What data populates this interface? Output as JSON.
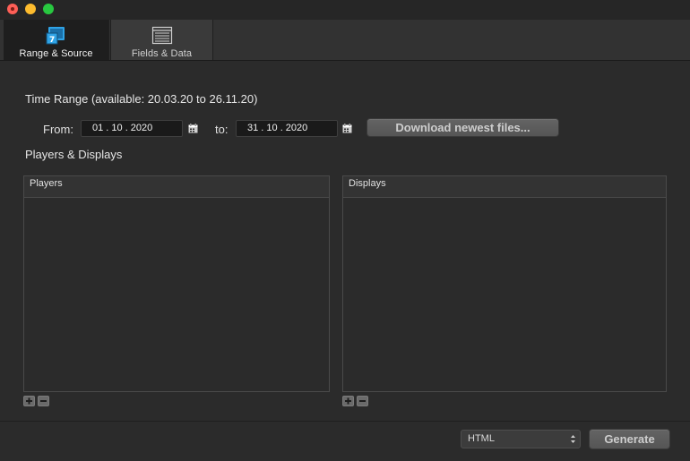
{
  "toolbar": {
    "tabs": [
      {
        "label": "Range & Source",
        "icon": "range-source-icon",
        "active": true
      },
      {
        "label": "Fields & Data",
        "icon": "fields-data-icon",
        "active": false
      }
    ]
  },
  "time_range": {
    "title": "Time Range (available: 20.03.20 to 26.11.20)",
    "from_label": "From:",
    "from_value": "01 . 10 . 2020",
    "to_label": "to:",
    "to_value": "31 . 10 . 2020",
    "download_button": "Download newest files..."
  },
  "players_displays": {
    "title": "Players & Displays",
    "players_header": "Players",
    "displays_header": "Displays"
  },
  "footer": {
    "format_value": "HTML",
    "generate_button": "Generate"
  },
  "colors": {
    "accent_icon": "#2fa3e6",
    "window_bg": "#2b2b2b"
  }
}
